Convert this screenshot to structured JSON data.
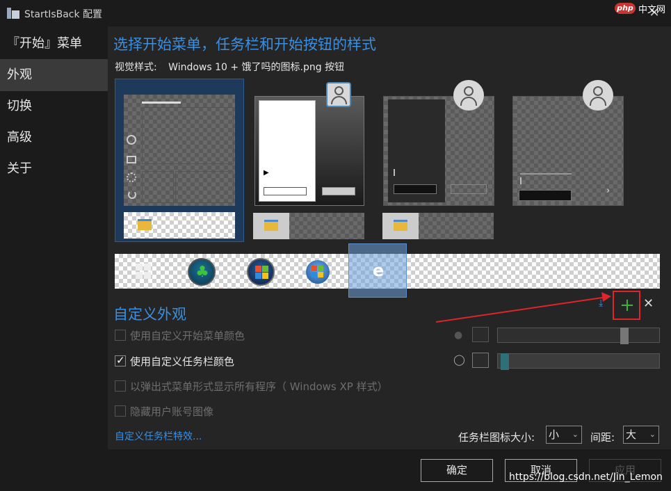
{
  "window": {
    "title": "StartIsBack 配置",
    "close_glyph": "✕",
    "watermark_badge": "php",
    "watermark_site": "中文网"
  },
  "sidebar": {
    "items": [
      {
        "label": "『开始』菜单"
      },
      {
        "label": "外观",
        "active": true
      },
      {
        "label": "切换"
      },
      {
        "label": "高级"
      },
      {
        "label": "关于"
      }
    ]
  },
  "main": {
    "heading": "选择开始菜单，任务栏和开始按钮的样式",
    "visual_style_label": "视觉样式:",
    "visual_style_value": "Windows 10 + 饿了吗的图标.png 按钮",
    "styles": [
      "windows-10",
      "windows-7",
      "plain-dark",
      "plain-gray"
    ],
    "start_buttons": [
      "windows-logo",
      "clover-orb",
      "windows-7-orb",
      "windows-orb",
      "edge-logo"
    ],
    "custom_heading": "自定义外观",
    "toolbar": {
      "download": "download-icon",
      "add": "plus-icon",
      "remove": "close-icon"
    },
    "options": [
      {
        "label": "使用自定义开始菜单颜色",
        "checked": false,
        "enabled": false
      },
      {
        "label": "使用自定义任务栏颜色",
        "checked": true,
        "enabled": true
      },
      {
        "label": "以弹出式菜单形式显示所有程序（ Windows XP 样式）",
        "checked": false,
        "enabled": false
      },
      {
        "label": "隐藏用户账号图像",
        "checked": false,
        "enabled": false
      }
    ],
    "start_menu_color": {
      "opacity": 0.8
    },
    "taskbar_color": {
      "accent": "#2f6f78",
      "opacity": 0.02
    },
    "taskbar_effects_link": "自定义任务栏特效...",
    "icon_size_label": "任务栏图标大小:",
    "icon_size_value": "小",
    "spacing_label": "间距:",
    "spacing_value": "大"
  },
  "footer": {
    "ok": "确定",
    "cancel": "取消",
    "apply": "应用",
    "url_watermark": "https://blog.csdn.net/Jin_Lemon"
  },
  "colors": {
    "accent_blue": "#3b8fe0",
    "highlight_red": "#e0242b",
    "add_green": "#3fae3f"
  }
}
